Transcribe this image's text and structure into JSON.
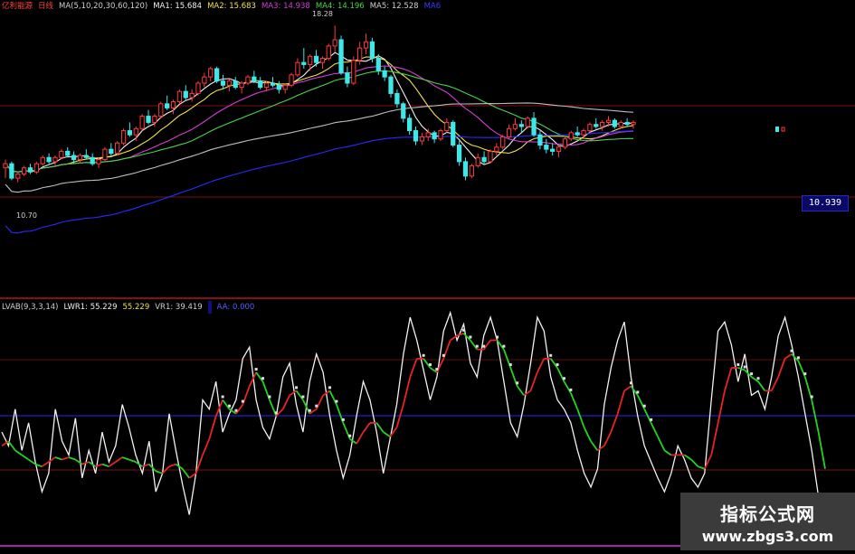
{
  "chart_data": [
    {
      "type": "candlestick",
      "header": {
        "title": "亿利能源",
        "period": "日线",
        "ma_label": "MA(5,10,20,30,60,120)",
        "ma1": "MA1: 15.684",
        "ma2": "MA2: 15.683",
        "ma3": "MA3: 14.938",
        "ma4": "MA4: 14.196",
        "ma5": "MA5: 12.528",
        "ma6": "MA6"
      },
      "high_label": "18.28",
      "low_label": "10.70",
      "current_price": "10.939",
      "ylim": [
        9.2,
        19.0
      ],
      "candles": [
        [
          11.4,
          11.8,
          10.9,
          11.6
        ],
        [
          11.6,
          11.7,
          10.8,
          10.9
        ],
        [
          10.9,
          11.2,
          10.7,
          11.1
        ],
        [
          11.1,
          11.5,
          11.0,
          11.4
        ],
        [
          11.4,
          11.6,
          11.1,
          11.2
        ],
        [
          11.2,
          11.7,
          11.1,
          11.6
        ],
        [
          11.6,
          12.0,
          11.5,
          11.9
        ],
        [
          11.9,
          12.1,
          11.6,
          11.7
        ],
        [
          11.7,
          12.0,
          11.5,
          11.9
        ],
        [
          11.9,
          12.3,
          11.8,
          12.2
        ],
        [
          12.2,
          12.4,
          11.9,
          12.0
        ],
        [
          12.0,
          12.2,
          11.6,
          11.8
        ],
        [
          11.8,
          12.1,
          11.6,
          12.0
        ],
        [
          12.0,
          12.3,
          11.8,
          11.9
        ],
        [
          11.9,
          12.1,
          11.5,
          11.6
        ],
        [
          11.6,
          11.9,
          11.4,
          11.8
        ],
        [
          11.8,
          12.4,
          11.7,
          12.3
        ],
        [
          12.3,
          12.6,
          12.0,
          12.1
        ],
        [
          12.1,
          12.7,
          12.0,
          12.6
        ],
        [
          12.6,
          13.3,
          12.5,
          13.2
        ],
        [
          13.2,
          13.6,
          12.9,
          13.0
        ],
        [
          13.0,
          13.4,
          12.7,
          13.3
        ],
        [
          13.3,
          14.0,
          13.2,
          13.9
        ],
        [
          13.9,
          14.2,
          13.5,
          13.6
        ],
        [
          13.6,
          14.0,
          13.4,
          13.9
        ],
        [
          13.9,
          14.6,
          13.8,
          14.5
        ],
        [
          14.5,
          14.9,
          14.2,
          14.3
        ],
        [
          14.3,
          14.7,
          14.0,
          14.6
        ],
        [
          14.6,
          15.2,
          14.5,
          15.1
        ],
        [
          15.1,
          15.4,
          14.7,
          14.8
        ],
        [
          14.8,
          15.2,
          14.6,
          15.0
        ],
        [
          15.0,
          15.6,
          14.9,
          15.5
        ],
        [
          15.5,
          16.0,
          15.3,
          15.8
        ],
        [
          15.8,
          16.3,
          15.6,
          16.2
        ],
        [
          16.2,
          16.3,
          15.5,
          15.6
        ],
        [
          15.6,
          15.9,
          15.2,
          15.4
        ],
        [
          15.4,
          15.7,
          15.1,
          15.6
        ],
        [
          15.6,
          15.8,
          15.2,
          15.3
        ],
        [
          15.3,
          15.6,
          15.0,
          15.5
        ],
        [
          15.5,
          15.9,
          15.4,
          15.8
        ],
        [
          15.8,
          16.1,
          15.5,
          15.6
        ],
        [
          15.6,
          15.8,
          15.2,
          15.3
        ],
        [
          15.3,
          15.6,
          15.1,
          15.5
        ],
        [
          15.5,
          15.8,
          15.3,
          15.4
        ],
        [
          15.4,
          15.6,
          15.0,
          15.2
        ],
        [
          15.2,
          15.5,
          15.0,
          15.4
        ],
        [
          15.4,
          16.0,
          15.3,
          15.9
        ],
        [
          15.9,
          16.7,
          15.8,
          16.5
        ],
        [
          16.5,
          17.2,
          16.2,
          16.4
        ],
        [
          16.4,
          16.9,
          16.1,
          16.8
        ],
        [
          16.8,
          17.1,
          16.3,
          16.5
        ],
        [
          16.5,
          16.8,
          16.2,
          16.7
        ],
        [
          16.7,
          17.4,
          16.6,
          17.3
        ],
        [
          17.3,
          18.28,
          17.0,
          17.6
        ],
        [
          17.6,
          17.8,
          15.9,
          16.0
        ],
        [
          16.0,
          16.3,
          15.3,
          15.5
        ],
        [
          15.5,
          16.8,
          15.4,
          16.6
        ],
        [
          16.6,
          17.5,
          16.4,
          17.2
        ],
        [
          17.2,
          17.9,
          16.9,
          17.5
        ],
        [
          17.5,
          17.7,
          16.5,
          16.7
        ],
        [
          16.7,
          16.9,
          15.9,
          16.1
        ],
        [
          16.1,
          16.3,
          15.6,
          15.8
        ],
        [
          15.8,
          15.9,
          14.8,
          15.0
        ],
        [
          15.0,
          15.2,
          14.3,
          14.5
        ],
        [
          14.5,
          14.6,
          13.6,
          13.8
        ],
        [
          13.8,
          14.0,
          13.0,
          13.2
        ],
        [
          13.2,
          13.4,
          12.5,
          12.7
        ],
        [
          12.7,
          13.1,
          12.5,
          12.9
        ],
        [
          12.9,
          13.3,
          12.7,
          13.1
        ],
        [
          13.1,
          13.2,
          12.6,
          12.8
        ],
        [
          12.8,
          13.3,
          12.7,
          13.2
        ],
        [
          13.2,
          13.8,
          13.1,
          13.6
        ],
        [
          13.6,
          13.7,
          12.4,
          12.5
        ],
        [
          12.5,
          12.7,
          11.5,
          11.7
        ],
        [
          11.7,
          11.9,
          10.8,
          11.0
        ],
        [
          11.0,
          11.6,
          10.9,
          11.5
        ],
        [
          11.5,
          12.1,
          11.4,
          11.9
        ],
        [
          11.9,
          12.2,
          11.6,
          11.7
        ],
        [
          11.7,
          12.3,
          11.6,
          12.2
        ],
        [
          12.2,
          12.6,
          12.0,
          12.4
        ],
        [
          12.4,
          13.0,
          12.3,
          12.9
        ],
        [
          12.9,
          13.5,
          12.8,
          13.3
        ],
        [
          13.3,
          13.8,
          13.2,
          13.5
        ],
        [
          13.5,
          13.7,
          13.1,
          13.4
        ],
        [
          13.4,
          13.9,
          13.3,
          13.8
        ],
        [
          13.8,
          14.1,
          12.9,
          13.0
        ],
        [
          13.0,
          13.2,
          12.3,
          12.5
        ],
        [
          12.5,
          12.8,
          12.1,
          12.3
        ],
        [
          12.3,
          12.6,
          12.0,
          12.2
        ],
        [
          12.2,
          12.5,
          11.9,
          12.4
        ],
        [
          12.4,
          12.9,
          12.3,
          12.8
        ],
        [
          12.8,
          13.2,
          12.7,
          13.1
        ],
        [
          13.1,
          13.4,
          12.9,
          13.0
        ],
        [
          13.0,
          13.3,
          12.8,
          13.2
        ],
        [
          13.2,
          13.6,
          13.1,
          13.5
        ],
        [
          13.5,
          13.8,
          13.3,
          13.4
        ],
        [
          13.4,
          13.7,
          13.2,
          13.6
        ],
        [
          13.6,
          13.9,
          13.4,
          13.7
        ],
        [
          13.7,
          13.8,
          13.3,
          13.4
        ],
        [
          13.4,
          13.7,
          13.3,
          13.6
        ],
        [
          13.6,
          13.8,
          13.4,
          13.5
        ],
        [
          13.5,
          13.7,
          13.3,
          13.6
        ]
      ],
      "ma_series": [
        {
          "label": "MA5",
          "color": "#f0f0f0",
          "period": 5
        },
        {
          "label": "MA10",
          "color": "#f0e24a",
          "period": 10
        },
        {
          "label": "MA20",
          "color": "#d63cd6",
          "period": 20
        },
        {
          "label": "MA30",
          "color": "#4bd34b",
          "period": 30
        },
        {
          "label": "MA60",
          "color": "#bdbdbd",
          "period": 60
        },
        {
          "label": "MA120",
          "color": "#2a2aff",
          "period": 120
        }
      ],
      "colors": {
        "up": "#ff3a3a",
        "down": "#3ee8e8",
        "grid_red": "#7a1010"
      }
    },
    {
      "type": "line",
      "header": {
        "name": "LVAB(9,3,3,14)",
        "lwr1": "LWR1: 55.229",
        "lwr2": "55.229",
        "vr1": "VR1: 39.419",
        "ma": "",
        "aa": "AA: 0.000"
      },
      "ylim": [
        0,
        100
      ],
      "white": [
        48,
        42,
        58,
        40,
        52,
        35,
        22,
        30,
        58,
        44,
        38,
        54,
        28,
        40,
        30,
        48,
        35,
        42,
        60,
        50,
        38,
        30,
        44,
        22,
        30,
        56,
        40,
        25,
        12,
        30,
        62,
        58,
        70,
        48,
        56,
        62,
        80,
        85,
        62,
        50,
        45,
        55,
        72,
        78,
        60,
        48,
        70,
        82,
        74,
        55,
        40,
        28,
        38,
        55,
        70,
        62,
        48,
        30,
        45,
        60,
        82,
        98,
        88,
        75,
        62,
        72,
        92,
        100,
        88,
        95,
        78,
        72,
        90,
        98,
        88,
        70,
        52,
        46,
        60,
        78,
        98,
        92,
        72,
        62,
        58,
        52,
        40,
        30,
        24,
        32,
        60,
        76,
        88,
        96,
        72,
        55,
        42,
        35,
        28,
        22,
        30,
        42,
        36,
        28,
        24,
        30,
        62,
        92,
        96,
        86,
        70,
        82,
        64,
        66,
        58,
        72,
        90,
        98,
        86,
        72,
        56,
        40,
        20,
        8
      ],
      "colored": [
        42,
        44,
        40,
        38,
        36,
        34,
        33,
        35,
        37,
        36,
        37,
        36,
        34,
        35,
        33,
        34,
        33,
        35,
        37,
        36,
        35,
        33,
        34,
        31,
        30,
        33,
        34,
        32,
        28,
        30,
        38,
        45,
        55,
        62,
        58,
        56,
        60,
        68,
        74,
        70,
        62,
        55,
        58,
        64,
        66,
        62,
        56,
        58,
        64,
        66,
        60,
        52,
        45,
        43,
        48,
        52,
        52,
        48,
        46,
        50,
        60,
        72,
        80,
        80,
        76,
        74,
        80,
        88,
        90,
        91,
        88,
        84,
        84,
        88,
        88,
        84,
        76,
        68,
        64,
        66,
        74,
        80,
        80,
        76,
        70,
        65,
        58,
        50,
        44,
        40,
        42,
        48,
        56,
        66,
        68,
        64,
        58,
        52,
        46,
        40,
        38,
        38,
        38,
        36,
        33,
        32,
        38,
        52,
        66,
        76,
        76,
        75,
        72,
        70,
        66,
        66,
        72,
        80,
        82,
        79,
        72,
        62,
        48,
        32
      ]
    }
  ],
  "watermark": {
    "cn": "指标公式网",
    "url": "www.zbgs3.com"
  }
}
